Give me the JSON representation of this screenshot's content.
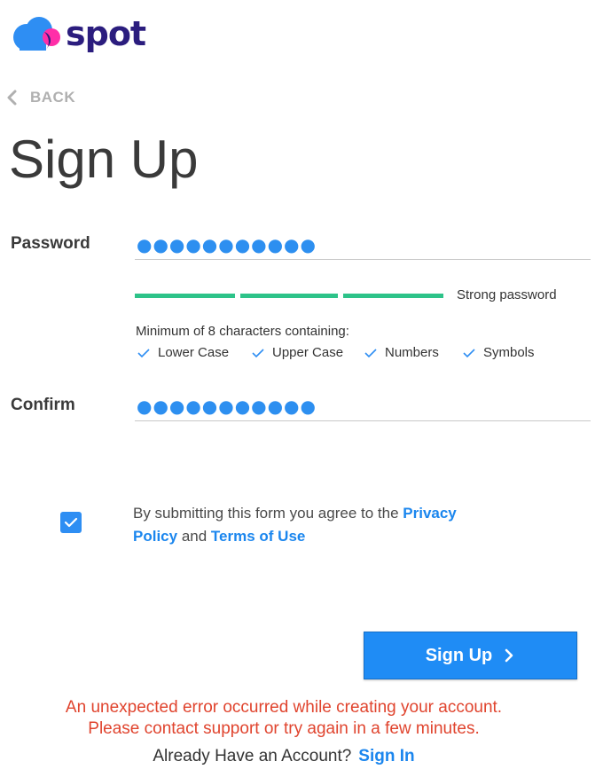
{
  "brand": {
    "name": "spot",
    "colors": {
      "text": "#2b1d7e",
      "cloud": "#2e8ef3",
      "dot": "#ff2ea8"
    }
  },
  "nav": {
    "back_label": "BACK"
  },
  "page": {
    "title": "Sign Up"
  },
  "form": {
    "password": {
      "label": "Password",
      "value": "●●●●●●●●●●●",
      "strength_label": "Strong password",
      "strength_level": "3/3",
      "strength_color": "#2dc389"
    },
    "requirements": {
      "title": "Minimum of 8 characters containing:",
      "items": [
        "Lower Case",
        "Upper Case",
        "Numbers",
        "Symbols"
      ]
    },
    "confirm": {
      "label": "Confirm",
      "value": "●●●●●●●●●●●"
    },
    "agreement": {
      "checked": true,
      "prefix": "By submitting this form you agree to the ",
      "privacy_link": "Privacy Policy",
      "connector": " and ",
      "terms_link": "Terms of Use"
    },
    "submit_label": "Sign Up"
  },
  "error": {
    "line1": "An unexpected error occurred while creating your account.",
    "line2": "Please contact support or try again in a few minutes.",
    "color": "#e0442e"
  },
  "footer": {
    "prompt": "Already Have an Account?",
    "signin_link": "Sign In"
  },
  "accent": "#1f8cf5"
}
